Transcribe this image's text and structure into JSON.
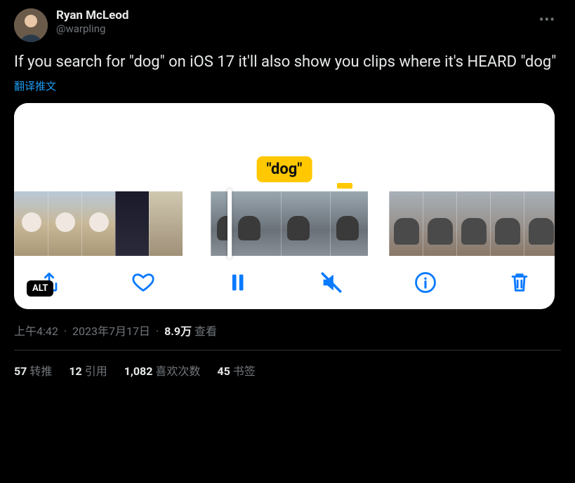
{
  "author": {
    "display_name": "Ryan McLeod",
    "handle": "@warpling"
  },
  "tweet_text": "If you search for \"dog\" on iOS 17 it'll also show you clips where it's HEARD \"dog\"",
  "translate_label": "翻译推文",
  "media": {
    "bubble_text": "\"dog\"",
    "alt_badge": "ALT",
    "toolbar_icons": [
      "share-icon",
      "heart-icon",
      "pause-icon",
      "mute-icon",
      "info-icon",
      "trash-icon"
    ]
  },
  "meta": {
    "time": "上午4:42",
    "date": "2023年7月17日",
    "views_value": "8.9万",
    "views_label": "查看"
  },
  "stats": {
    "retweets": {
      "count": "57",
      "label": "转推"
    },
    "quotes": {
      "count": "12",
      "label": "引用"
    },
    "likes": {
      "count": "1,082",
      "label": "喜欢次数"
    },
    "bookmarks": {
      "count": "45",
      "label": "书签"
    }
  }
}
